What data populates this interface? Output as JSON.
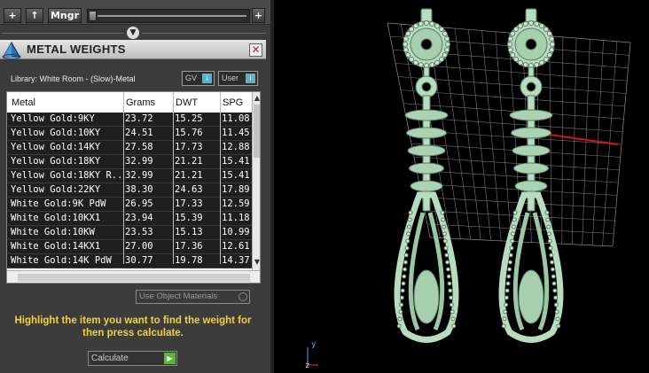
{
  "toolbar": {
    "add_label": "+",
    "up_label": "↑",
    "manager_label": "Mngr",
    "zoom_plus_label": "+"
  },
  "panel": {
    "title": "METAL WEIGHTS",
    "close_label": "✕",
    "library_label": "Library: White Room - (Slow)-Metal",
    "gv_label": "GV",
    "user_label": "User"
  },
  "table": {
    "headers": [
      "Metal",
      "Grams",
      "DWT",
      "SPG"
    ],
    "rows": [
      [
        "Yellow Gold:9KY",
        "23.72",
        "15.25",
        "11.08"
      ],
      [
        "Yellow Gold:10KY",
        "24.51",
        "15.76",
        "11.45"
      ],
      [
        "Yellow Gold:14KY",
        "27.58",
        "17.73",
        "12.88"
      ],
      [
        "Yellow Gold:18KY",
        "32.99",
        "21.21",
        "15.41"
      ],
      [
        "Yellow Gold:18KY R...",
        "32.99",
        "21.21",
        "15.41"
      ],
      [
        "Yellow Gold:22KY",
        "38.30",
        "24.63",
        "17.89"
      ],
      [
        "White Gold:9K PdW",
        "26.95",
        "17.33",
        "12.59"
      ],
      [
        "White Gold:10KX1",
        "23.94",
        "15.39",
        "11.18"
      ],
      [
        "White Gold:10KW",
        "23.53",
        "15.13",
        "10.99"
      ],
      [
        "White Gold:14KX1",
        "27.00",
        "17.36",
        "12.61"
      ],
      [
        "White Gold:14K PdW",
        "30.77",
        "19.78",
        "14.37"
      ]
    ]
  },
  "use_object_materials_label": "Use Object Materials",
  "hint": "Highlight the item you want to find the weight for then press calculate.",
  "calculate_label": "Calculate",
  "axes": {
    "y": "y",
    "z": "z"
  },
  "colors": {
    "panel_bg": "#3c3c3c",
    "hint_text": "#f2d23c",
    "model_mint": "#b8dcc0",
    "grid_line": "#9a9a9a",
    "x_axis_red": "#d01818"
  }
}
